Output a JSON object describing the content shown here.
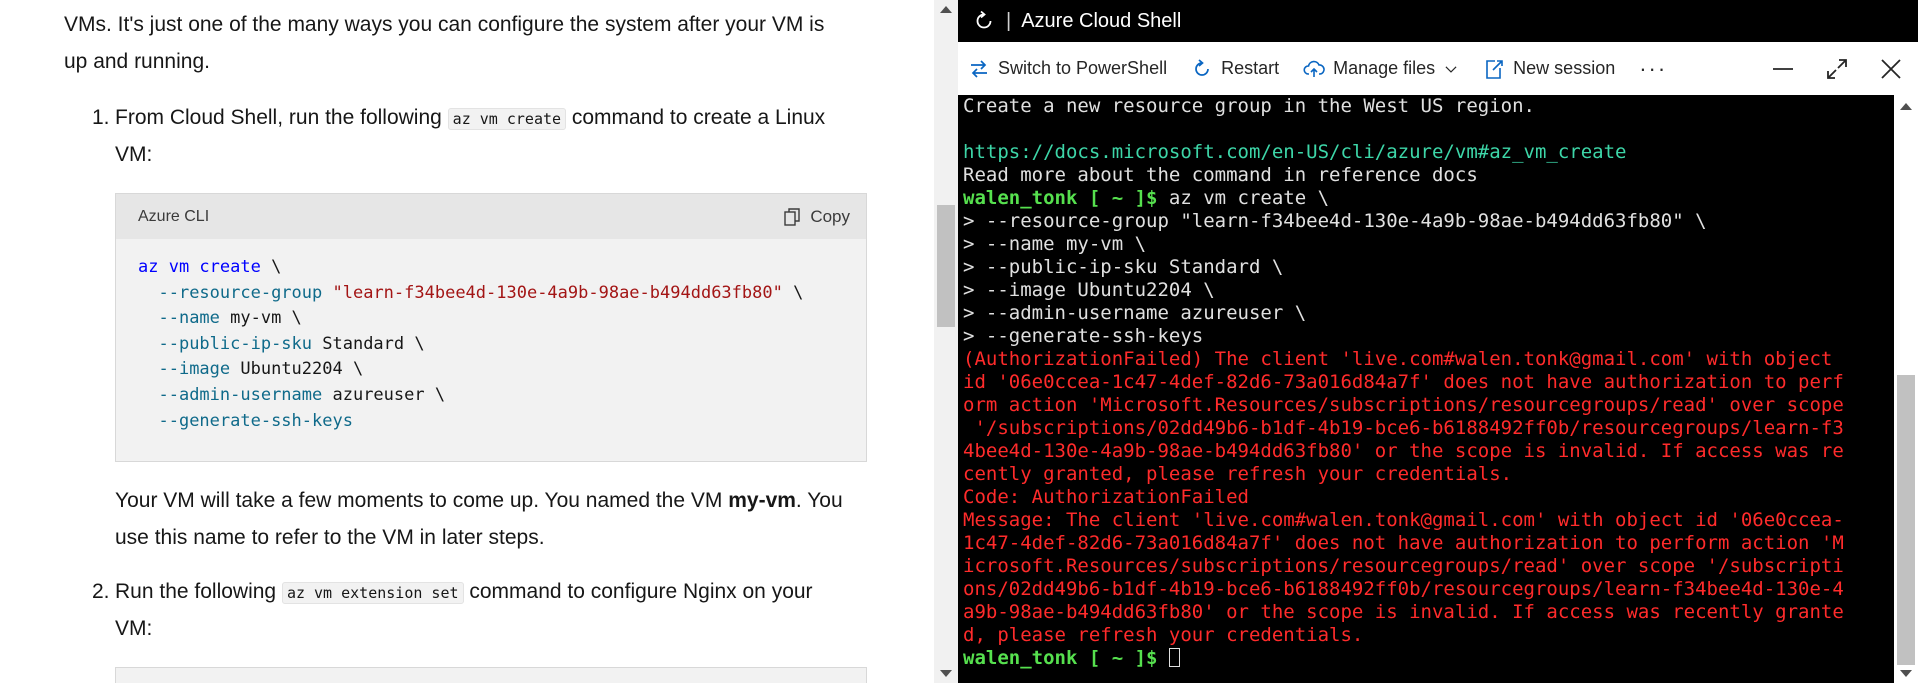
{
  "doc": {
    "intro_line1": "VMs. It's just one of the many ways you can configure the system after your VM is",
    "intro_line2": "up and running.",
    "step1": {
      "number": "1.",
      "text_before": "From Cloud Shell, run the following ",
      "code": "az vm create",
      "text_after": " command to create a Linux",
      "text_line2": "VM:"
    },
    "codeblock": {
      "lang": "Azure CLI",
      "copy_label": "Copy",
      "lines": [
        {
          "kw": "az vm create",
          "rest": " \\"
        },
        {
          "param": "--resource-group",
          "str": "\"learn-f34bee4d-130e-4a9b-98ae-b494dd63fb80\"",
          "rest": " \\"
        },
        {
          "param": "--name",
          "rest": " my-vm \\"
        },
        {
          "param": "--public-ip-sku",
          "rest": " Standard \\"
        },
        {
          "param": "--image",
          "rest": " Ubuntu2204 \\"
        },
        {
          "param": "--admin-username",
          "rest": " azureuser \\"
        },
        {
          "param": "--generate-ssh-keys",
          "rest": ""
        }
      ]
    },
    "vm_note": {
      "before": "Your VM will take a few moments to come up. You named the VM ",
      "bold": "my-vm",
      "after": ". You",
      "line2": "use this name to refer to the VM in later steps."
    },
    "step2": {
      "number": "2.",
      "text_before": "Run the following ",
      "code": "az vm extension set",
      "text_after": " command to configure Nginx on your",
      "text_line2": "VM:"
    }
  },
  "shell": {
    "title": "Azure Cloud Shell",
    "toolbar": {
      "switch_label": "Switch to PowerShell",
      "restart_label": "Restart",
      "manage_files_label": "Manage files",
      "new_session_label": "New session",
      "more_label": "···"
    },
    "terminal": {
      "line_top": "Create a new resource group in the West US region.",
      "link": "https://docs.microsoft.com/en-US/cli/azure/vm#az_vm_create",
      "read_more": "Read more about the command in reference docs",
      "prompt": "walen_tonk [ ~ ]$",
      "command": " az vm create \\",
      "continuation": [
        "> --resource-group \"learn-f34bee4d-130e-4a9b-98ae-b494dd63fb80\" \\",
        "> --name my-vm \\",
        "> --public-ip-sku Standard \\",
        "> --image Ubuntu2204 \\",
        "> --admin-username azureuser \\",
        "> --generate-ssh-keys"
      ],
      "error_lines": [
        "(AuthorizationFailed) The client 'live.com#walen.tonk@gmail.com' with object",
        "id '06e0ccea-1c47-4def-82d6-73a016d84a7f' does not have authorization to perf",
        "orm action 'Microsoft.Resources/subscriptions/resourcegroups/read' over scope",
        " '/subscriptions/02dd49b6-b1df-4b19-bce6-b6188492ff0b/resourcegroups/learn-f3",
        "4bee4d-130e-4a9b-98ae-b494dd63fb80' or the scope is invalid. If access was re",
        "cently granted, please refresh your credentials.",
        "Code: AuthorizationFailed",
        "Message: The client 'live.com#walen.tonk@gmail.com' with object id '06e0ccea-",
        "1c47-4def-82d6-73a016d84a7f' does not have authorization to perform action 'M",
        "icrosoft.Resources/subscriptions/resourcegroups/read' over scope '/subscripti",
        "ons/02dd49b6-b1df-4b19-bce6-b6188492ff0b/resourcegroups/learn-f34bee4d-130e-4",
        "a9b-98ae-b494dd63fb80' or the scope is invalid. If access was recently grante",
        "d, please refresh your credentials."
      ],
      "final_prompt": "walen_tonk [ ~ ]$"
    }
  },
  "colors": {
    "terminal_bg": "#000000",
    "prompt": "#56e04e",
    "link": "#3dd6a8",
    "error": "#ff2b2b",
    "code_keyword": "#0000ff",
    "code_param": "#0f6a8a",
    "code_string": "#a31515"
  },
  "icons": [
    "refresh-icon",
    "switch-icon",
    "restart-icon",
    "upload-icon",
    "chevron-down-icon",
    "new-session-icon",
    "minimize-icon",
    "maximize-icon",
    "close-icon",
    "copy-icon"
  ]
}
